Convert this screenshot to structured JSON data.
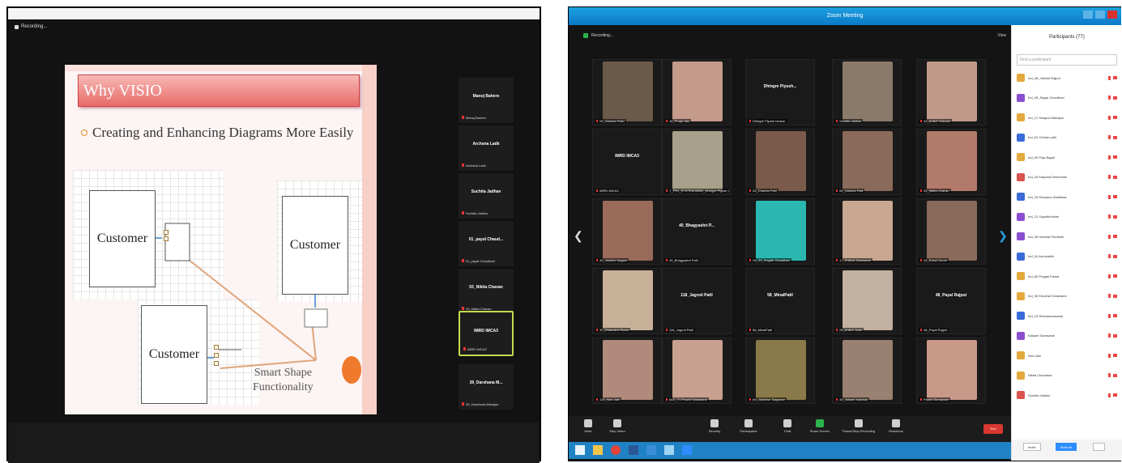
{
  "left": {
    "recording_label": "Recording...",
    "slide": {
      "title": "Why VISIO",
      "bullet": "Creating and Enhancing  Diagrams More Easily",
      "box_label": "Customer",
      "smart_shape_line1": "Smart Shape",
      "smart_shape_line2": "Functionality"
    },
    "participants": [
      {
        "name": "Manoj Bahere",
        "sub": "Manoj Bahere"
      },
      {
        "name": "Archana Ladk",
        "sub": "Archana Ladk"
      },
      {
        "name": "Suchita Jadhav",
        "sub": "Suchita Jadhav"
      },
      {
        "name": "01_payal Chaud...",
        "sub": "01_payal Chaudhari"
      },
      {
        "name": "03_Nikita Chavan",
        "sub": "03_Nikita Chavan"
      },
      {
        "name": "IMRD IMCA3",
        "sub": "IMRD IMCA3"
      },
      {
        "name": "39_Darshana M...",
        "sub": "39_Darshana Mahajan"
      }
    ]
  },
  "right": {
    "window_title": "Zoom Meeting",
    "recording_label": "Recording...",
    "view_label": "View",
    "tiles": [
      {
        "name": "",
        "label": "09_Harshal Patel",
        "photo": "#6b5a4a"
      },
      {
        "name": "",
        "label": "16_Pooja Jain",
        "photo": "#c49a8a"
      },
      {
        "name": "Dhingre Piyush...",
        "label": "Dhingre Piyush Ishwar",
        "photo": ""
      },
      {
        "name": "",
        "label": "Suchita Jadhav",
        "photo": "#8a7a6a"
      },
      {
        "name": "",
        "label": "44_Aniket Salunke",
        "photo": "#c09a88"
      },
      {
        "name": "IMRD IMCA3",
        "label": "IMRD IMCA3",
        "photo": ""
      },
      {
        "name": "",
        "label": "T_PRJ_SYSTEM IMRD_Dhingre Piyush Ishwar",
        "photo": "#a8a08a"
      },
      {
        "name": "",
        "label": "28_Chanda Patil",
        "photo": "#7a5a4a"
      },
      {
        "name": "",
        "label": "05_Harshal Patil",
        "photo": "#8a6a5a"
      },
      {
        "name": "",
        "label": "33_Nikita Chavan",
        "photo": "#b27a6a"
      },
      {
        "name": "",
        "label": "40_Jamkini Nagare",
        "photo": "#9a6a5a"
      },
      {
        "name": "40_Bhagyashri P...",
        "label": "40_Bhagyashri Patil",
        "photo": ""
      },
      {
        "name": "",
        "label": "Sh_33_Snigdh Chaudhari",
        "photo": "#2ab8b0"
      },
      {
        "name": "",
        "label": "17_Shikha Sonawane",
        "photo": "#c8a890"
      },
      {
        "name": "",
        "label": "34_Rahul Deore",
        "photo": "#8a6a5a"
      },
      {
        "name": "",
        "label": "32_Dhanashri Borse",
        "photo": "#c8b098"
      },
      {
        "name": "118_Jagruti Patil",
        "label": "118_Jagruti Patil",
        "photo": ""
      },
      {
        "name": "58_MinalPatil",
        "label": "58_MinalPatil",
        "photo": ""
      },
      {
        "name": "",
        "label": "28_Aniket Joshi",
        "photo": "#c2b0a0"
      },
      {
        "name": "48_Payal Rajput",
        "label": "48_Payal Rajput",
        "photo": ""
      },
      {
        "name": "",
        "label": "120_Isha Jain",
        "photo": "#b08a7a"
      },
      {
        "name": "",
        "label": "MJL_T1 Prachi Sonawane",
        "photo": "#c8a090"
      },
      {
        "name": "",
        "label": "69_Jaikishor Sagwane",
        "photo": "#8a7a4a"
      },
      {
        "name": "",
        "label": "49_Jaikant Kashkar",
        "photo": "#9a8070"
      },
      {
        "name": "",
        "label": "Prachi Sonawane",
        "photo": "#c89888"
      }
    ],
    "controls": [
      "Mute",
      "Stop Video",
      "Security",
      "Participants",
      "Chat",
      "Share Screen",
      "Pause/Stop Recording",
      "Reactions"
    ],
    "end_label": "End",
    "panel": {
      "title": "Participants (77)",
      "search_placeholder": "Find a participant",
      "rows": [
        {
          "name": "Ind_48_Jaikant Rajput",
          "color": "#e3a93c"
        },
        {
          "name": "Ind_09_Sagar Chaudhari",
          "color": "#8a4fd1"
        },
        {
          "name": "Ind_12 Swapnil Mahajan",
          "color": "#e3a93c"
        },
        {
          "name": "Ind_51 Chetan patil",
          "color": "#3a6bd9"
        },
        {
          "name": "Ind_09 Puja Bagal",
          "color": "#e3a93c"
        },
        {
          "name": "Ind_16 Kalpana Deshmukh",
          "color": "#d9534f"
        },
        {
          "name": "Ind_15 Deepana Sadhekar",
          "color": "#3a6bd9"
        },
        {
          "name": "Ind_21 Gayathrirokde",
          "color": "#8a4fd1"
        },
        {
          "name": "Ind_08 Harshal Pardeshi",
          "color": "#8a4fd1"
        },
        {
          "name": "Ind_34 Arunkathik",
          "color": "#3a6bd9"
        },
        {
          "name": "Ind_60 Pragati Pawar",
          "color": "#e3a93c"
        },
        {
          "name": "Ind_06 Khushal Sonawane",
          "color": "#e3a93c"
        },
        {
          "name": "Ind_15 Rekhasonawane",
          "color": "#3a6bd9"
        },
        {
          "name": "Kalyani Sonawane",
          "color": "#8a4fd1"
        },
        {
          "name": "Isha Jain",
          "color": "#e3a93c"
        },
        {
          "name": "Nikita Chaudhari",
          "color": "#e3a93c"
        },
        {
          "name": "Suchita Jadhav",
          "color": "#d9534f"
        }
      ],
      "invite": "Invite",
      "mute_all": "Mute All",
      "more": "..."
    }
  }
}
